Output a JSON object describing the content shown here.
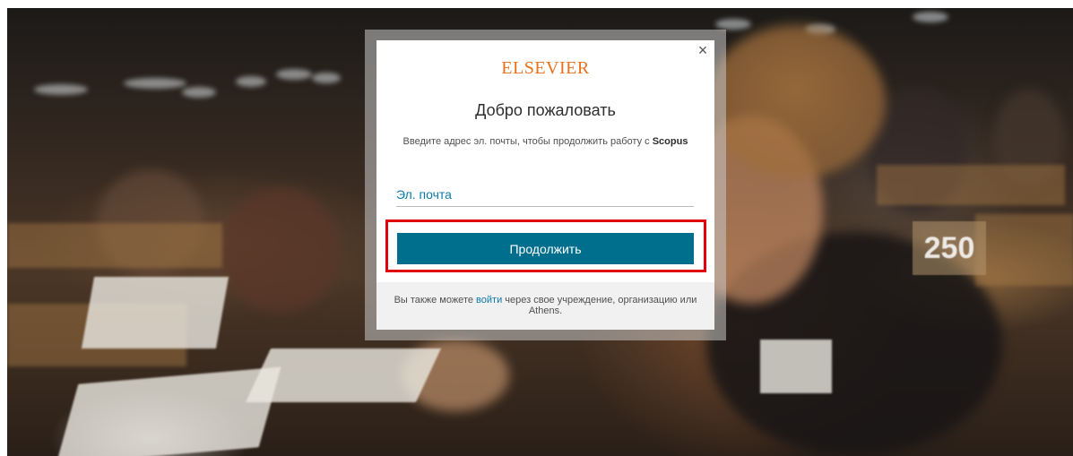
{
  "modal": {
    "close_icon": "×",
    "logo": "ELSEVIER",
    "title": "Добро пожаловать",
    "subtitle_prefix": "Введите адрес эл. почты, чтобы продолжить работу с",
    "subtitle_brand": "Scopus",
    "email_placeholder": "Эл. почта",
    "email_value": "",
    "continue_label": "Продолжить",
    "footer_prefix": "Вы также можете",
    "footer_link": "войти",
    "footer_suffix": "через свое учреждение, организацию или Athens."
  },
  "background": {
    "desk_number": "250"
  },
  "colors": {
    "logo": "#e9711c",
    "button": "#006f8e",
    "link": "#0c7aa8",
    "highlight": "#e1000f"
  }
}
